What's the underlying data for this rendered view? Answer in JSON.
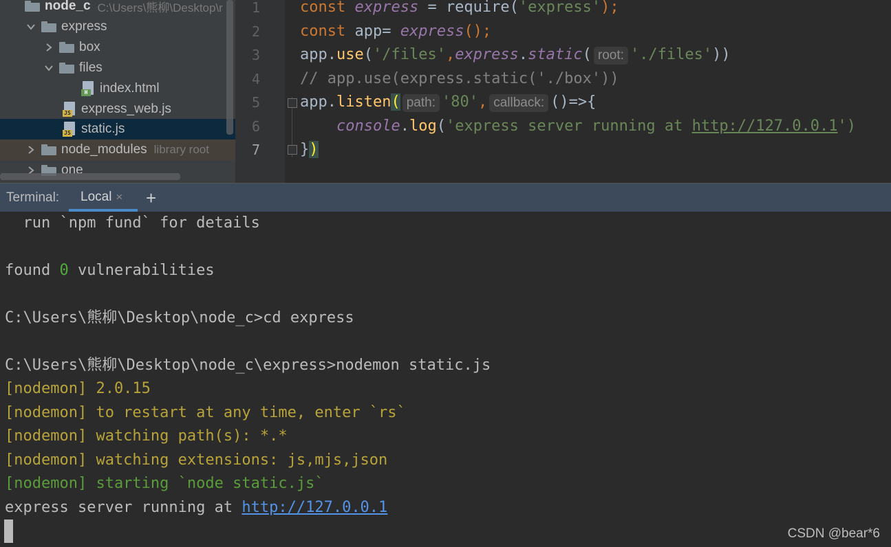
{
  "project_tree": {
    "items": [
      {
        "label": "node_c",
        "hint": "C:\\Users\\熊柳\\Desktop\\r"
      },
      {
        "label": "express"
      },
      {
        "label": "box"
      },
      {
        "label": "files"
      },
      {
        "label": "index.html",
        "icon_tag": "H"
      },
      {
        "label": "express_web.js",
        "icon_tag": "JS"
      },
      {
        "label": "static.js",
        "icon_tag": "JS"
      },
      {
        "label": "node_modules",
        "hint": "library root"
      },
      {
        "label": "one"
      }
    ]
  },
  "editor": {
    "line_numbers": [
      "1",
      "2",
      "3",
      "4",
      "5",
      "6",
      "7"
    ],
    "lines": [
      {
        "t0": "const ",
        "t1": "express",
        "t2": " = require(",
        "t3": "'express'",
        "t4": ");"
      },
      {
        "t0": "const ",
        "t1": "app= ",
        "t2": "express",
        "t3": "();"
      },
      {
        "t0": "app.",
        "t1": "use",
        "t2": "(",
        "t3": "'/files'",
        "t4": ",",
        "t5": "express",
        "t6": ".",
        "t7": "static",
        "t8": "(",
        "hint": "root:",
        "t9": "'./files'",
        "t10": "))"
      },
      {
        "t0": "// app.use(express.static('./box'))"
      },
      {
        "t0": "app.",
        "t1": "listen",
        "t2": "(",
        "hint1": "path:",
        "t3": "'80'",
        "t4": ",",
        "hint2": "callback:",
        "t5": "()=>{"
      },
      {
        "t0": "    ",
        "t1": "console",
        "t2": ".",
        "t3": "log",
        "t4": "(",
        "t5": "'express server running at ",
        "t6": "http://127.0.0.1",
        "t7": "')"
      },
      {
        "t0": "}",
        "t1": ")"
      }
    ]
  },
  "terminal": {
    "title": "Terminal:",
    "tab_label": "Local",
    "tab_close": "×",
    "add_label": "+",
    "lines": [
      {
        "a": "  run `npm fund` for details"
      },
      {
        "a": ""
      },
      {
        "a": "found ",
        "b": "0",
        "c": " vulnerabilities"
      },
      {
        "a": ""
      },
      {
        "a": "C:\\Users\\熊柳\\Desktop\\node_c>cd express"
      },
      {
        "a": ""
      },
      {
        "a": "C:\\Users\\熊柳\\Desktop\\node_c\\express>nodemon static.js"
      },
      {
        "a": "[nodemon] 2.0.15"
      },
      {
        "a": "[nodemon] to restart at any time, enter `rs`"
      },
      {
        "a": "[nodemon] watching path(s): *.*"
      },
      {
        "a": "[nodemon] watching extensions: js,mjs,json"
      },
      {
        "a": "[nodemon] starting `node static.js`"
      },
      {
        "a": "express server running at ",
        "b": "http://127.0.0.1"
      }
    ],
    "watermark": "CSDN @bear*6"
  },
  "colors": {
    "keyword": "#cc7832",
    "string": "#6a8759",
    "method": "#ffc66d",
    "italic_var": "#9876aa",
    "nodemon_yellow": "#b8a33a",
    "nodemon_green": "#5a9c3a",
    "link": "#5393e8"
  }
}
